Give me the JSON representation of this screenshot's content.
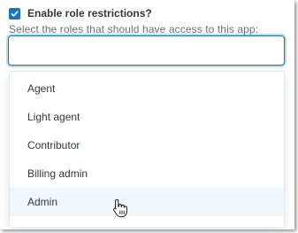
{
  "restriction": {
    "checkbox_label": "Enable role restrictions?",
    "checked": true,
    "hint": "Select the roles that should have access to this app:",
    "input_value": ""
  },
  "dropdown": {
    "options": [
      {
        "label": "Agent"
      },
      {
        "label": "Light agent"
      },
      {
        "label": "Contributor"
      },
      {
        "label": "Billing admin"
      },
      {
        "label": "Admin"
      }
    ],
    "hovered_option": "Admin"
  },
  "colors": {
    "accent": "#1f73b7",
    "text": "#2f3941",
    "hint_text": "#68737d",
    "hover_bg": "#edf7ff"
  },
  "icons": {
    "checkbox": "checkmark-icon",
    "cursor": "hand-pointer-cursor-icon"
  }
}
